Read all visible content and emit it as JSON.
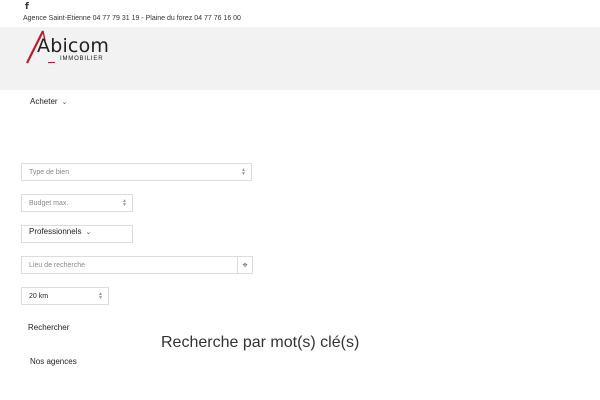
{
  "topbar": {
    "facebook_icon": "facebook-icon",
    "contact_text": "Agence Saint-Etienne 04 77 79 31 19 - Plaine du forez 04 77 76 16 00"
  },
  "logo": {
    "main": "Abicom",
    "sub": "IMMOBILIER",
    "accent_color": "#c0182a"
  },
  "nav": {
    "acheter": "Acheter",
    "professionnels": "Professionnels",
    "chevron_icon": "chevron-down-icon"
  },
  "search": {
    "property_type_placeholder": "Type de bien",
    "budget_placeholder": "Budget max.",
    "location_placeholder": "Lieu de recherche",
    "locate_icon": "crosshair-icon",
    "radius_value": "20 km",
    "submit_label": "Rechercher"
  },
  "keyword_title": "Recherche par mot(s) clé(s)",
  "agencies_label": "Nos agences",
  "colors": {
    "header_band": "#f2f2f2",
    "border": "#dcdcdc"
  }
}
